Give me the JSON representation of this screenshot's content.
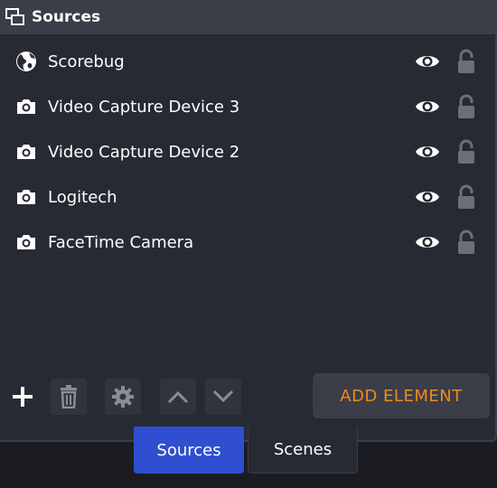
{
  "header": {
    "title": "Sources",
    "icon": "sources-icon"
  },
  "sources": [
    {
      "label": "Scorebug",
      "icon": "globe-icon"
    },
    {
      "label": "Video Capture Device 3",
      "icon": "camera-icon"
    },
    {
      "label": "Video Capture Device 2",
      "icon": "camera-icon"
    },
    {
      "label": "Logitech",
      "icon": "camera-icon"
    },
    {
      "label": "FaceTime Camera",
      "icon": "camera-icon"
    }
  ],
  "toolbar": {
    "add_element_label": "ADD ELEMENT"
  },
  "tabs": [
    {
      "label": "Sources",
      "active": true
    },
    {
      "label": "Scenes",
      "active": false
    }
  ],
  "colors": {
    "accent": "#f08a1c",
    "active_tab": "#2f4fd0",
    "panel": "#272a33",
    "header": "#3b3e48"
  }
}
